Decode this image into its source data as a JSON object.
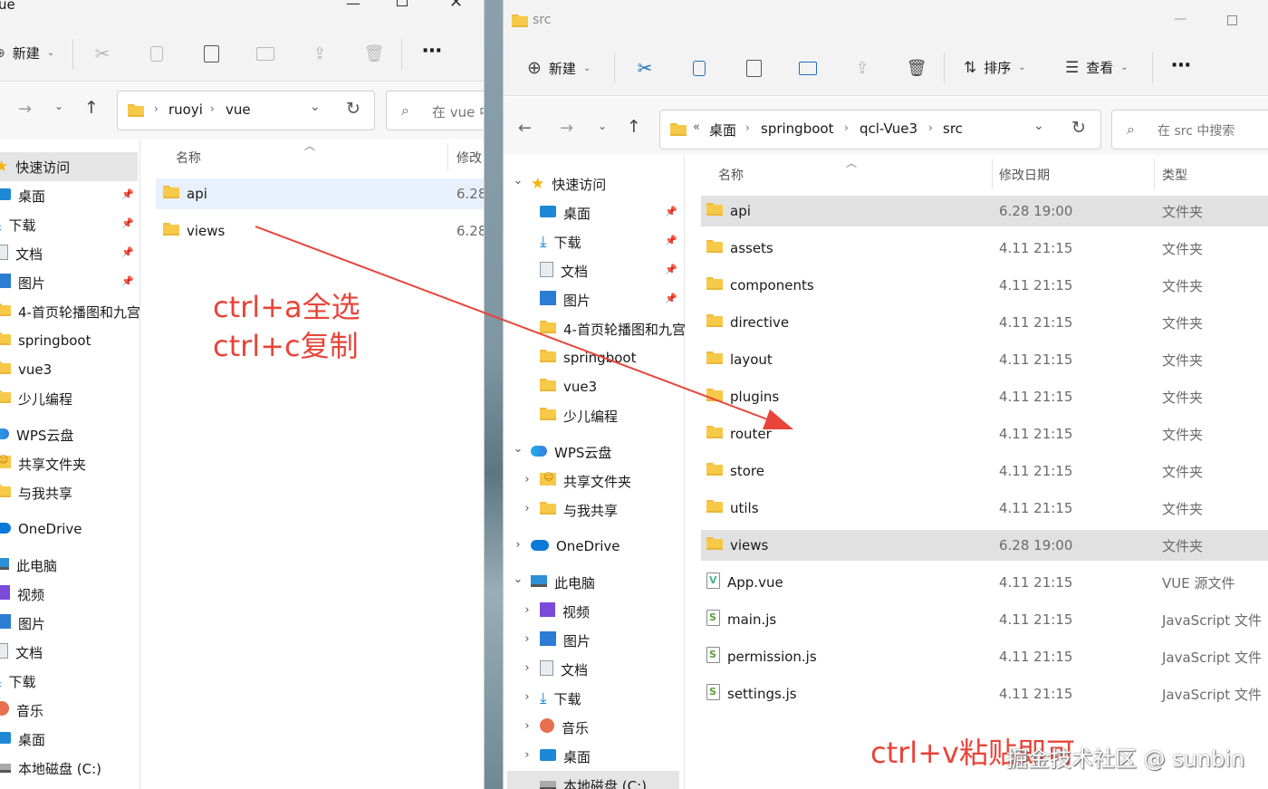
{
  "left_window": {
    "title": "ue",
    "toolbar": {
      "new_label": "新建"
    },
    "address": [
      "ruoyi",
      "vue"
    ],
    "search_placeholder": "在 vue 中",
    "columns": {
      "name": "名称",
      "date": "修改"
    },
    "files": [
      {
        "name": "api",
        "date": "6.28",
        "selected": true
      },
      {
        "name": "views",
        "date": "6.28",
        "selected": false
      }
    ],
    "nav": [
      {
        "label": "快速访问",
        "icon": "star-icon",
        "pinned": false
      },
      {
        "label": "桌面",
        "icon": "desktop-icon",
        "pinned": true
      },
      {
        "label": "下载",
        "icon": "download-icon",
        "pinned": true
      },
      {
        "label": "文档",
        "icon": "document-icon",
        "pinned": true
      },
      {
        "label": "图片",
        "icon": "picture-icon",
        "pinned": true
      },
      {
        "label": "4-首页轮播图和九宫",
        "icon": "folder-icon",
        "pinned": false
      },
      {
        "label": "springboot",
        "icon": "folder-icon",
        "pinned": false
      },
      {
        "label": "vue3",
        "icon": "folder-icon",
        "pinned": false
      },
      {
        "label": "少儿编程",
        "icon": "folder-icon",
        "pinned": false
      },
      {
        "label": "WPS云盘",
        "icon": "wps-cloud-icon",
        "pinned": false
      },
      {
        "label": "共享文件夹",
        "icon": "shared-folder-icon",
        "pinned": false
      },
      {
        "label": "与我共享",
        "icon": "folder-icon",
        "pinned": false
      },
      {
        "label": "OneDrive",
        "icon": "onedrive-icon",
        "pinned": false
      },
      {
        "label": "此电脑",
        "icon": "pc-icon",
        "pinned": false
      },
      {
        "label": "视频",
        "icon": "video-icon",
        "pinned": false
      },
      {
        "label": "图片",
        "icon": "picture-icon",
        "pinned": false
      },
      {
        "label": "文档",
        "icon": "document-icon",
        "pinned": false
      },
      {
        "label": "下载",
        "icon": "download-icon",
        "pinned": false
      },
      {
        "label": "音乐",
        "icon": "music-icon",
        "pinned": false
      },
      {
        "label": "桌面",
        "icon": "desktop-icon",
        "pinned": false
      },
      {
        "label": "本地磁盘 (C:)",
        "icon": "disk-icon",
        "pinned": false
      }
    ]
  },
  "right_window": {
    "title": "src",
    "toolbar": {
      "new_label": "新建",
      "sort_label": "排序",
      "view_label": "查看"
    },
    "address": [
      "桌面",
      "springboot",
      "qcl-Vue3",
      "src"
    ],
    "search_placeholder": "在 src 中搜索",
    "columns": {
      "name": "名称",
      "date": "修改日期",
      "type": "类型"
    },
    "files": [
      {
        "name": "api",
        "date": "6.28 19:00",
        "type": "文件夹",
        "kind": "folder",
        "selected": true
      },
      {
        "name": "assets",
        "date": "4.11 21:15",
        "type": "文件夹",
        "kind": "folder",
        "selected": false
      },
      {
        "name": "components",
        "date": "4.11 21:15",
        "type": "文件夹",
        "kind": "folder",
        "selected": false
      },
      {
        "name": "directive",
        "date": "4.11 21:15",
        "type": "文件夹",
        "kind": "folder",
        "selected": false
      },
      {
        "name": "layout",
        "date": "4.11 21:15",
        "type": "文件夹",
        "kind": "folder",
        "selected": false
      },
      {
        "name": "plugins",
        "date": "4.11 21:15",
        "type": "文件夹",
        "kind": "folder",
        "selected": false
      },
      {
        "name": "router",
        "date": "4.11 21:15",
        "type": "文件夹",
        "kind": "folder",
        "selected": false
      },
      {
        "name": "store",
        "date": "4.11 21:15",
        "type": "文件夹",
        "kind": "folder",
        "selected": false
      },
      {
        "name": "utils",
        "date": "4.11 21:15",
        "type": "文件夹",
        "kind": "folder",
        "selected": false
      },
      {
        "name": "views",
        "date": "6.28 19:00",
        "type": "文件夹",
        "kind": "folder",
        "selected": true
      },
      {
        "name": "App.vue",
        "date": "4.11 21:15",
        "type": "VUE 源文件",
        "kind": "vue",
        "selected": false
      },
      {
        "name": "main.js",
        "date": "4.11 21:15",
        "type": "JavaScript 文件",
        "kind": "js",
        "selected": false
      },
      {
        "name": "permission.js",
        "date": "4.11 21:15",
        "type": "JavaScript 文件",
        "kind": "js",
        "selected": false
      },
      {
        "name": "settings.js",
        "date": "4.11 21:15",
        "type": "JavaScript 文件",
        "kind": "js",
        "selected": false
      }
    ],
    "nav": [
      {
        "label": "快速访问",
        "icon": "star-icon",
        "level": 0,
        "expander": "down",
        "pinned": false
      },
      {
        "label": "桌面",
        "icon": "desktop-icon",
        "level": 1,
        "expander": "",
        "pinned": true
      },
      {
        "label": "下载",
        "icon": "download-icon",
        "level": 1,
        "expander": "",
        "pinned": true
      },
      {
        "label": "文档",
        "icon": "document-icon",
        "level": 1,
        "expander": "",
        "pinned": true
      },
      {
        "label": "图片",
        "icon": "picture-icon",
        "level": 1,
        "expander": "",
        "pinned": true
      },
      {
        "label": "4-首页轮播图和九宫",
        "icon": "folder-icon",
        "level": 1,
        "expander": "",
        "pinned": false
      },
      {
        "label": "springboot",
        "icon": "folder-icon",
        "level": 1,
        "expander": "",
        "pinned": false
      },
      {
        "label": "vue3",
        "icon": "folder-icon",
        "level": 1,
        "expander": "",
        "pinned": false
      },
      {
        "label": "少儿编程",
        "icon": "folder-icon",
        "level": 1,
        "expander": "",
        "pinned": false
      },
      {
        "label": "WPS云盘",
        "icon": "wps-cloud-icon",
        "level": 0,
        "expander": "down",
        "pinned": false
      },
      {
        "label": "共享文件夹",
        "icon": "shared-folder-icon",
        "level": 1,
        "expander": "right",
        "pinned": false
      },
      {
        "label": "与我共享",
        "icon": "folder-icon",
        "level": 1,
        "expander": "right",
        "pinned": false
      },
      {
        "label": "OneDrive",
        "icon": "onedrive-icon",
        "level": 0,
        "expander": "right",
        "pinned": false
      },
      {
        "label": "此电脑",
        "icon": "pc-icon",
        "level": 0,
        "expander": "down",
        "pinned": false
      },
      {
        "label": "视频",
        "icon": "video-icon",
        "level": 1,
        "expander": "right",
        "pinned": false
      },
      {
        "label": "图片",
        "icon": "picture-icon",
        "level": 1,
        "expander": "right",
        "pinned": false
      },
      {
        "label": "文档",
        "icon": "document-icon",
        "level": 1,
        "expander": "right",
        "pinned": false
      },
      {
        "label": "下载",
        "icon": "download-icon",
        "level": 1,
        "expander": "right",
        "pinned": false
      },
      {
        "label": "音乐",
        "icon": "music-icon",
        "level": 1,
        "expander": "right",
        "pinned": false
      },
      {
        "label": "桌面",
        "icon": "desktop-icon",
        "level": 1,
        "expander": "right",
        "pinned": false
      },
      {
        "label": "本地磁盘 (C:)",
        "icon": "disk-icon",
        "level": 1,
        "expander": "right",
        "pinned": false,
        "selected": true
      }
    ]
  },
  "annotations": {
    "select_all": "ctrl+a全选",
    "copy": "ctrl+c复制",
    "paste": "ctrl+v粘贴即可",
    "color": "#e8443a"
  },
  "watermark": "掘金技术社区 @ sunbin"
}
